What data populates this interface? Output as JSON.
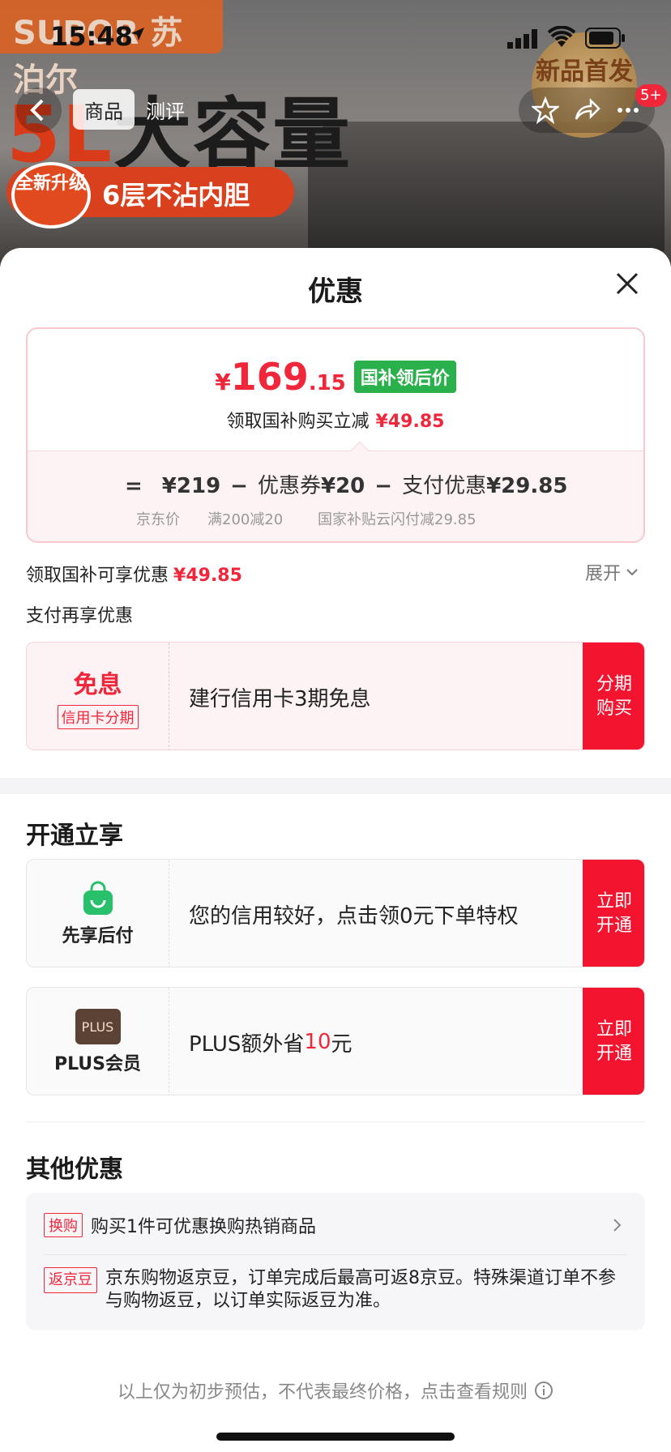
{
  "status": {
    "time": "15:48"
  },
  "background": {
    "brand": "SUPOR 苏泊尔",
    "headline_red": "5L",
    "headline_dark": "大容量",
    "seal": "全新升级",
    "pill": "6层不沾内胆",
    "medal": "新品首发"
  },
  "nav": {
    "tabs": [
      {
        "label": "商品"
      },
      {
        "label": "测评"
      }
    ],
    "badge": "5+"
  },
  "sheet": {
    "title": "优惠",
    "price": {
      "yen": "¥",
      "int": "169",
      "dec": ".15",
      "tag": "国补领后价",
      "sub_label": "领取国补购买立减",
      "sub_value": "¥49.85"
    },
    "formula": {
      "eq": "=",
      "base": "¥219",
      "minus1": "−",
      "coupon_label": "优惠券",
      "coupon_value": "¥20",
      "minus2": "−",
      "pay_label": "支付优惠",
      "pay_value": "¥29.85",
      "note_base": "京东价",
      "note_coupon": "满200减20",
      "note_pay": "国家补贴云闪付减29.85"
    },
    "subsidy_label": "领取国补可享优惠",
    "subsidy_value": "¥49.85",
    "expand": "展开",
    "pay_more": "支付再享优惠",
    "installment": {
      "title": "免息",
      "tag": "信用卡分期",
      "text": "建行信用卡3期免息",
      "btn_line1": "分期",
      "btn_line2": "购买"
    },
    "open_section": "开通立享",
    "pay_later": {
      "label": "先享后付",
      "text": "您的信用较好，点击领0元下单特权",
      "btn_line1": "立即",
      "btn_line2": "开通"
    },
    "plus": {
      "logo": "PLUS",
      "label": "PLUS会员",
      "text_before": "PLUS额外省",
      "text_num": "10",
      "text_after": "元",
      "btn_line1": "立即",
      "btn_line2": "开通"
    },
    "other_section": "其他优惠",
    "other": {
      "row1_tag": "换购",
      "row1_text": "购买1件可优惠换购热销商品",
      "row2_tag": "返京豆",
      "row2_text": "京东购物返京豆，订单完成后最高可返8京豆。特殊渠道订单不参与购物返豆，以订单实际返豆为准。"
    },
    "footer": "以上仅为初步预估，不代表最终价格，点击查看规则"
  },
  "colors": {
    "accent": "#f0263b",
    "green_tag": "#2bb14c",
    "button": "#f31430"
  }
}
